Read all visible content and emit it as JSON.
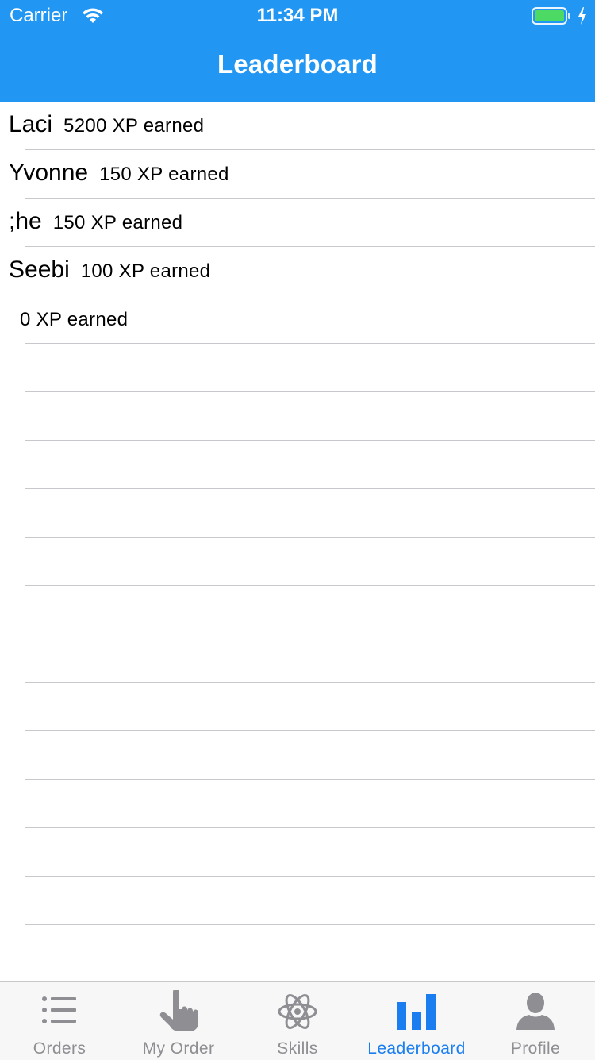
{
  "status_bar": {
    "carrier": "Carrier",
    "time": "11:34 PM",
    "battery_color": "#4cd964"
  },
  "nav": {
    "title": "Leaderboard"
  },
  "leaderboard": {
    "entries": [
      {
        "name": "Laci",
        "xp": "5200 XP earned"
      },
      {
        "name": "Yvonne",
        "xp": "150 XP earned"
      },
      {
        "name": ";he",
        "xp": "150 XP earned"
      },
      {
        "name": "Seebi",
        "xp": "100 XP earned"
      },
      {
        "name": "",
        "xp": "0 XP earned"
      }
    ],
    "empty_rows": 13
  },
  "tabbar": {
    "tabs": [
      {
        "label": "Orders",
        "icon": "list-icon",
        "active": false
      },
      {
        "label": "My Order",
        "icon": "pointing-hand-icon",
        "active": false
      },
      {
        "label": "Skills",
        "icon": "atom-icon",
        "active": false
      },
      {
        "label": "Leaderboard",
        "icon": "bar-chart-icon",
        "active": true
      },
      {
        "label": "Profile",
        "icon": "person-icon",
        "active": false
      }
    ],
    "active_color": "#1a7ef0",
    "inactive_color": "#8e8e93"
  },
  "colors": {
    "header": "#2196f3"
  }
}
